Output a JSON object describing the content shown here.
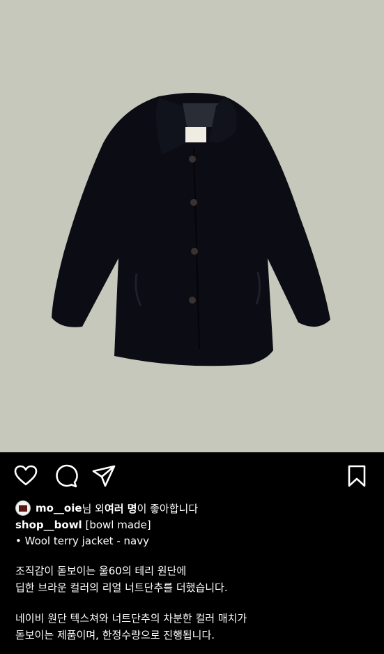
{
  "post": {
    "image_alt": "Navy wool terry jacket",
    "likes": {
      "user": "mo__oie",
      "suffix1": "님 외 ",
      "others": "여러 명",
      "suffix2": "이 좋아합니다"
    },
    "caption": {
      "username": "shop__bowl",
      "title": "[bowl made]",
      "item_line": "• Wool terry jacket - navy",
      "para1_line1": "조직감이 돋보이는 울60의 테리 원단에",
      "para1_line2": "딥한 브라운 컬러의 리얼 너트단추를 더했습니다.",
      "para2_line1": "네이비 원단 텍스쳐와 너트단추의 차분한 컬러 매치가",
      "para2_line2": "돋보이는 제품이며, 한정수량으로 진행됩니다."
    }
  },
  "icons": [
    "heart-icon",
    "comment-icon",
    "send-icon",
    "bookmark-icon"
  ],
  "colors": {
    "photo_bg": "#c6c8bb",
    "jacket": "#0b0c14",
    "feed_bg": "#000000"
  }
}
